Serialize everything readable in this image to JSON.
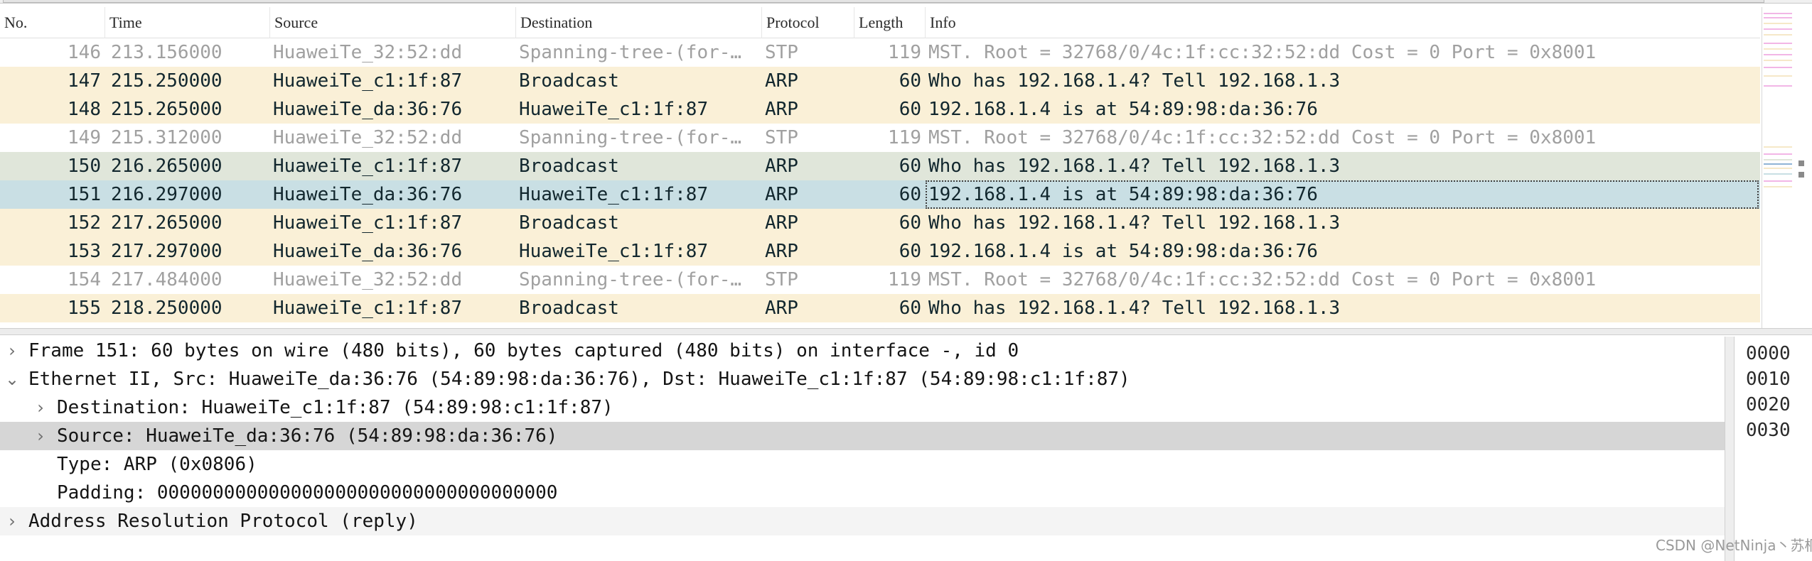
{
  "packet_list": {
    "columns": [
      "No.",
      "Time",
      "Source",
      "Destination",
      "Protocol",
      "Length",
      "Info"
    ],
    "rows": [
      {
        "no": "146",
        "time": "213.156000",
        "source": "HuaweiTe_32:52:dd",
        "destination": "Spanning-tree-(for-…",
        "protocol": "STP",
        "length": "119",
        "info": "MST. Root = 32768/0/4c:1f:cc:32:52:dd  Cost = 0  Port = 0x8001",
        "kind": "stp"
      },
      {
        "no": "147",
        "time": "215.250000",
        "source": "HuaweiTe_c1:1f:87",
        "destination": "Broadcast",
        "protocol": "ARP",
        "length": "60",
        "info": "Who has 192.168.1.4? Tell 192.168.1.3",
        "kind": "arp"
      },
      {
        "no": "148",
        "time": "215.265000",
        "source": "HuaweiTe_da:36:76",
        "destination": "HuaweiTe_c1:1f:87",
        "protocol": "ARP",
        "length": "60",
        "info": "192.168.1.4 is at 54:89:98:da:36:76",
        "kind": "arp"
      },
      {
        "no": "149",
        "time": "215.312000",
        "source": "HuaweiTe_32:52:dd",
        "destination": "Spanning-tree-(for-…",
        "protocol": "STP",
        "length": "119",
        "info": "MST. Root = 32768/0/4c:1f:cc:32:52:dd  Cost = 0  Port = 0x8001",
        "kind": "stp"
      },
      {
        "no": "150",
        "time": "216.265000",
        "source": "HuaweiTe_c1:1f:87",
        "destination": "Broadcast",
        "protocol": "ARP",
        "length": "60",
        "info": "Who has 192.168.1.4? Tell 192.168.1.3",
        "kind": "arp-marked"
      },
      {
        "no": "151",
        "time": "216.297000",
        "source": "HuaweiTe_da:36:76",
        "destination": "HuaweiTe_c1:1f:87",
        "protocol": "ARP",
        "length": "60",
        "info": "192.168.1.4 is at 54:89:98:da:36:76",
        "kind": "selected"
      },
      {
        "no": "152",
        "time": "217.265000",
        "source": "HuaweiTe_c1:1f:87",
        "destination": "Broadcast",
        "protocol": "ARP",
        "length": "60",
        "info": "Who has 192.168.1.4? Tell 192.168.1.3",
        "kind": "arp"
      },
      {
        "no": "153",
        "time": "217.297000",
        "source": "HuaweiTe_da:36:76",
        "destination": "HuaweiTe_c1:1f:87",
        "protocol": "ARP",
        "length": "60",
        "info": "192.168.1.4 is at 54:89:98:da:36:76",
        "kind": "arp"
      },
      {
        "no": "154",
        "time": "217.484000",
        "source": "HuaweiTe_32:52:dd",
        "destination": "Spanning-tree-(for-…",
        "protocol": "STP",
        "length": "119",
        "info": "MST. Root = 32768/0/4c:1f:cc:32:52:dd  Cost = 0  Port = 0x8001",
        "kind": "stp"
      },
      {
        "no": "155",
        "time": "218.250000",
        "source": "HuaweiTe_c1:1f:87",
        "destination": "Broadcast",
        "protocol": "ARP",
        "length": "60",
        "info": "Who has 192.168.1.4? Tell 192.168.1.3",
        "kind": "arp"
      }
    ]
  },
  "details": {
    "items": [
      {
        "text": "Frame 151: 60 bytes on wire (480 bits), 60 bytes captured (480 bits) on interface -, id 0",
        "level": 0,
        "arrow": "›",
        "style": ""
      },
      {
        "text": "Ethernet II, Src: HuaweiTe_da:36:76 (54:89:98:da:36:76), Dst: HuaweiTe_c1:1f:87 (54:89:98:c1:1f:87)",
        "level": 0,
        "arrow": "⌄",
        "style": ""
      },
      {
        "text": "Destination: HuaweiTe_c1:1f:87 (54:89:98:c1:1f:87)",
        "level": 1,
        "arrow": "›",
        "style": ""
      },
      {
        "text": "Source: HuaweiTe_da:36:76 (54:89:98:da:36:76)",
        "level": 1,
        "arrow": "›",
        "style": "sel"
      },
      {
        "text": "Type: ARP (0x0806)",
        "level": 1,
        "arrow": "",
        "style": ""
      },
      {
        "text": "Padding: 000000000000000000000000000000000000",
        "level": 1,
        "arrow": "",
        "style": ""
      },
      {
        "text": "Address Resolution Protocol (reply)",
        "level": 0,
        "arrow": "›",
        "style": "alt"
      }
    ]
  },
  "hex_offsets": [
    "0000",
    "0010",
    "0020",
    "0030"
  ],
  "watermark": "CSDN @NetNinja丶苏桐",
  "colors": {
    "arp_row": "#faf0d7",
    "stp_row": "#ffffff",
    "marked_row": "#e0e6da",
    "selected_row": "#c9dfe4",
    "selected_tree": "#d6d6d6"
  }
}
